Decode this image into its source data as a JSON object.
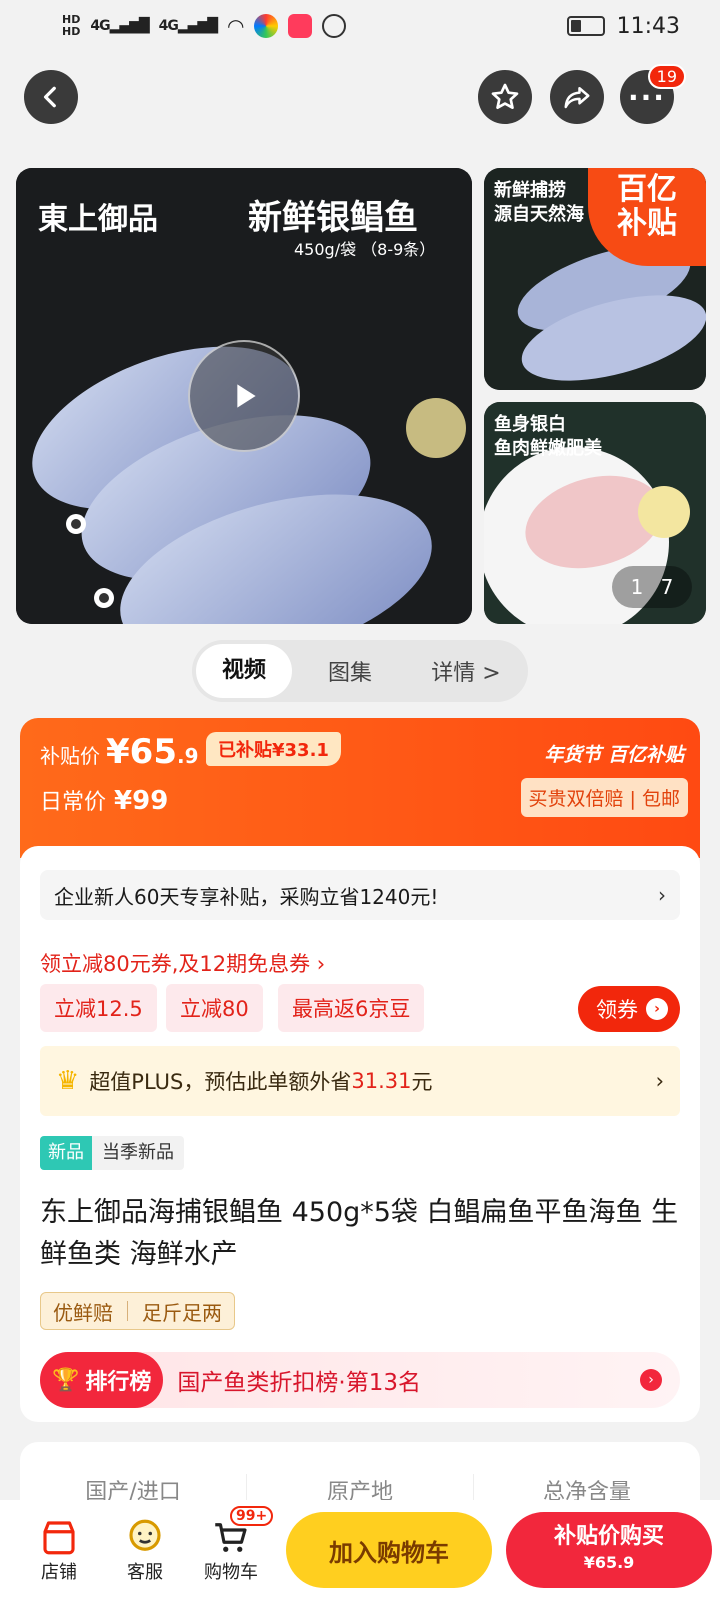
{
  "status": {
    "time": "11:43",
    "net1": "4G",
    "net2": "4G",
    "hd1": "HD",
    "hd2": "HD"
  },
  "nav": {
    "badge": "19"
  },
  "gallery": {
    "brand": "東上御品",
    "main_title": "新鲜银鲳鱼",
    "main_sub": "450g/袋 （8-9条）",
    "side1_text1": "新鲜捕捞",
    "side1_text2": "源自天然海",
    "side2_text1": "鱼身银白",
    "side2_text2": "鱼肉鲜嫩肥美",
    "subsidy_line1": "百亿",
    "subsidy_line2": "补贴",
    "pager_current": "1",
    "pager_total": "7"
  },
  "tabs": [
    {
      "label": "视频"
    },
    {
      "label": "图集"
    },
    {
      "label": "详情 >"
    }
  ],
  "price": {
    "subsidy_label": "补贴价",
    "subsidy_price": "¥65",
    "subsidy_decimal": ".9",
    "already_subsidy": "已补贴¥33.1",
    "daily_label": "日常价",
    "daily_price": "¥99",
    "brand_right": "年货节 百亿补贴",
    "guarantee": "买贵双倍赔 | 包邮"
  },
  "promo": {
    "enterprise": "企业新人60天专享补贴，采购立省1240元!",
    "coupon_link": "领立减80元券,及12期免息券 ›",
    "chips": [
      "立减12.5",
      "立减80",
      "最高返6京豆"
    ],
    "get_coupon": "领券",
    "plus_text": "超值PLUS，预估此单额外省",
    "plus_amount": "31.31",
    "plus_unit": "元"
  },
  "product": {
    "new_tag": "新品",
    "new_desc": "当季新品",
    "title": "东上御品海捕银鲳鱼 450g*5袋 白鲳扁鱼平鱼海鱼 生鲜鱼类 海鲜水产",
    "tag1": "优鲜赔",
    "tag2": "足斤足两",
    "rank_label": "排行榜",
    "rank_text": "国产鱼类折扣榜·第13名"
  },
  "spec": [
    "国产/进口",
    "原产地",
    "总净含量"
  ],
  "bottom": {
    "shop": "店铺",
    "service": "客服",
    "cart": "购物车",
    "cart_badge": "99+",
    "add_cart": "加入购物车",
    "buy": "补贴价购买",
    "buy_price": "¥65.9"
  },
  "colors": {
    "accent": "#f2270c",
    "orange": "#ff5a14",
    "yellow": "#ffcf1f"
  }
}
